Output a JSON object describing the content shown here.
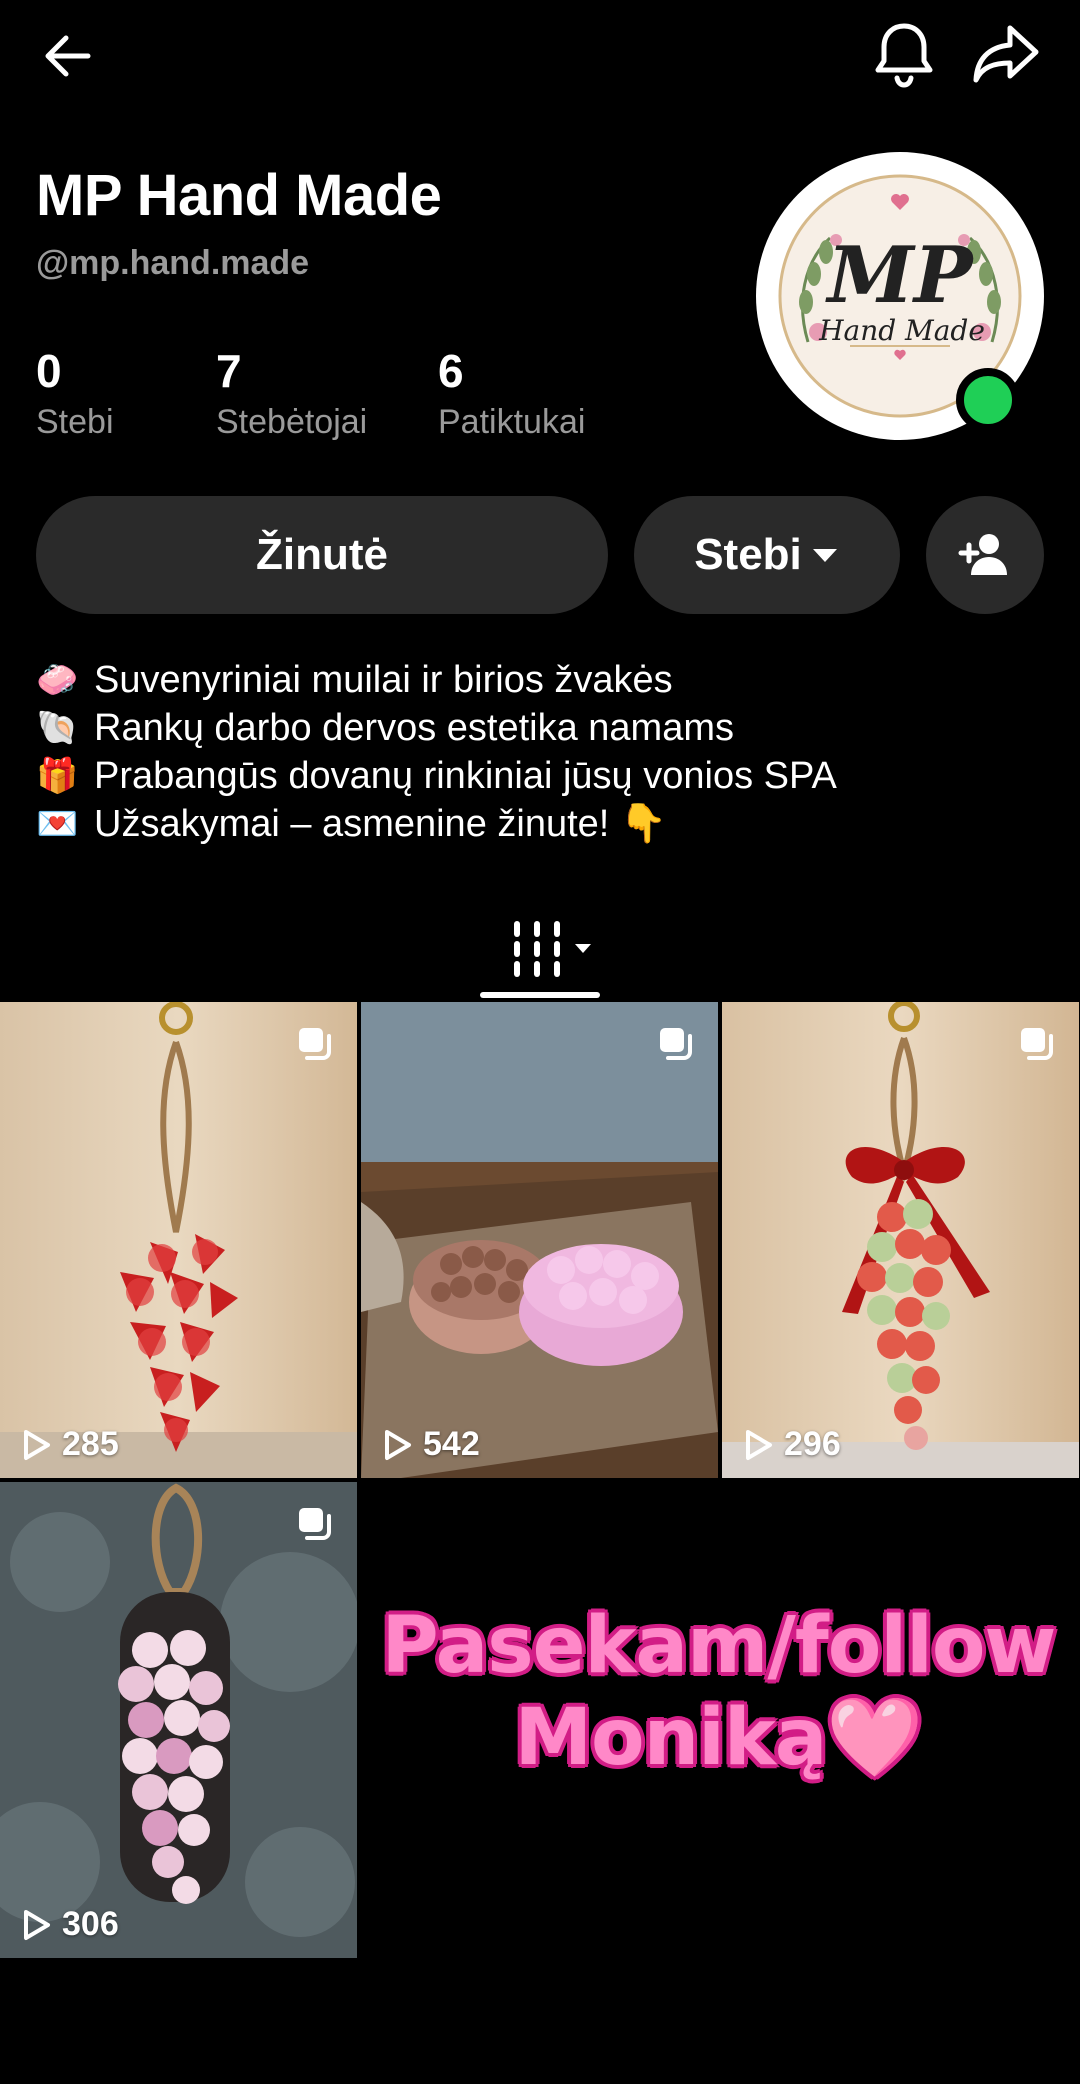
{
  "profile": {
    "name": "MP Hand Made",
    "handle": "@mp.hand.made",
    "avatar_logo": {
      "line1": "MP",
      "line2": "Hand Made"
    }
  },
  "stats": [
    {
      "value": "0",
      "label": "Stebi"
    },
    {
      "value": "7",
      "label": "Stebėtojai"
    },
    {
      "value": "6",
      "label": "Patiktukai"
    }
  ],
  "actions": {
    "message_label": "Žinutė",
    "following_label": "Stebi"
  },
  "bio": [
    {
      "emoji": "🧼",
      "text": "Suvenyriniai muilai ir birios žvakės"
    },
    {
      "emoji": "🐚",
      "text": "Rankų darbo dervos estetika namams"
    },
    {
      "emoji": "🎁",
      "text": "Prabangūs dovanų rinkiniai jūsų vonios SPA"
    },
    {
      "emoji": "💌",
      "text": "Užsakymai – asmenine žinute! 👇"
    }
  ],
  "videos": [
    {
      "views": "285",
      "subject": "strawberry-hanging-soap"
    },
    {
      "views": "542",
      "subject": "massage-soap-bars"
    },
    {
      "views": "296",
      "subject": "grape-soap-with-bow"
    },
    {
      "views": "306",
      "subject": "pink-grape-soap"
    }
  ],
  "overlay": {
    "line1": "Pasekam/follow",
    "line2": "Moniką🩷"
  },
  "colors": {
    "online": "#1fcf56",
    "button_bg": "#2a2a2a",
    "overlay_pink": "#ff88c8"
  }
}
